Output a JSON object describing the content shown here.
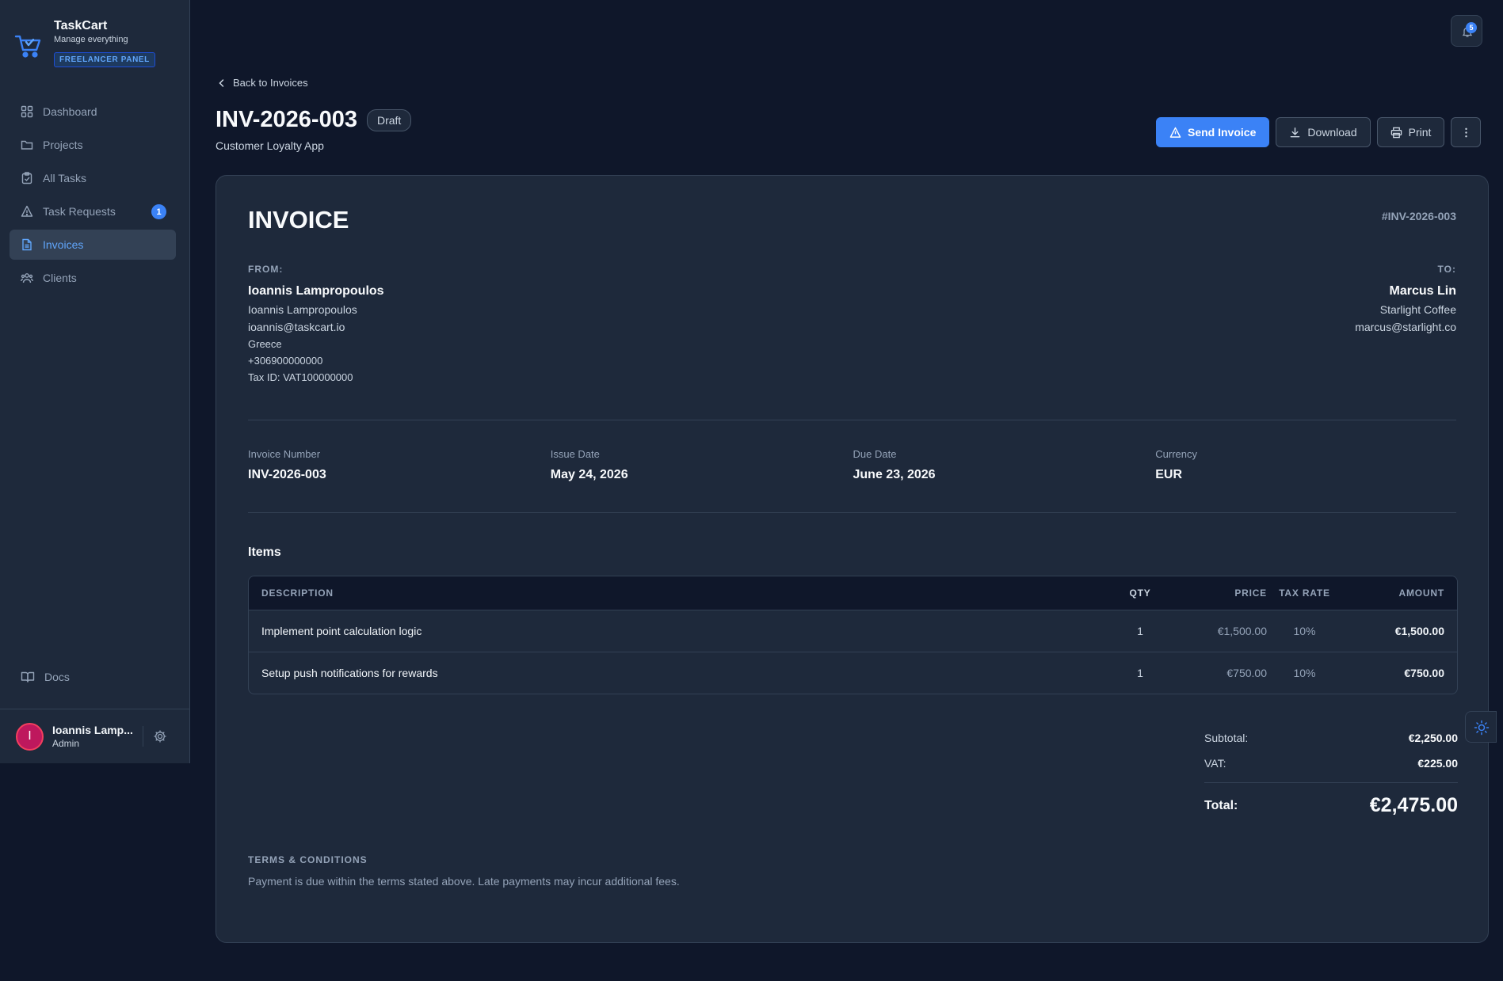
{
  "brand": {
    "name": "TaskCart",
    "tagline": "Manage everything",
    "panel": "FREELANCER PANEL"
  },
  "sidebar": {
    "items": [
      {
        "label": "Dashboard",
        "icon": "grid-icon"
      },
      {
        "label": "Projects",
        "icon": "folder-icon"
      },
      {
        "label": "All Tasks",
        "icon": "clipboard-check-icon"
      },
      {
        "label": "Task Requests",
        "icon": "warning-icon",
        "badge": "1"
      },
      {
        "label": "Invoices",
        "icon": "document-icon",
        "active": true
      },
      {
        "label": "Clients",
        "icon": "users-icon"
      }
    ],
    "docs": "Docs",
    "user": {
      "initial": "I",
      "name": "Ioannis Lamp...",
      "role": "Admin"
    }
  },
  "notifications": {
    "count": "5"
  },
  "header": {
    "back": "Back to Invoices",
    "title": "INV-2026-003",
    "status": "Draft",
    "subtitle": "Customer Loyalty App",
    "actions": {
      "send": "Send Invoice",
      "download": "Download",
      "print": "Print"
    }
  },
  "invoice": {
    "heading": "INVOICE",
    "number_ref": "#INV-2026-003",
    "from": {
      "label": "FROM:",
      "name": "Ioannis Lampropoulos",
      "company": "Ioannis Lampropoulos",
      "email": "ioannis@taskcart.io",
      "country": "Greece",
      "phone": "+306900000000",
      "tax_id": "Tax ID: VAT100000000"
    },
    "to": {
      "label": "TO:",
      "name": "Marcus Lin",
      "company": "Starlight Coffee",
      "email": "marcus@starlight.co"
    },
    "meta": [
      {
        "label": "Invoice Number",
        "value": "INV-2026-003"
      },
      {
        "label": "Issue Date",
        "value": "May 24, 2026"
      },
      {
        "label": "Due Date",
        "value": "June 23, 2026"
      },
      {
        "label": "Currency",
        "value": "EUR"
      }
    ],
    "items_title": "Items",
    "columns": {
      "description": "DESCRIPTION",
      "qty": "QTY",
      "price": "PRICE",
      "tax": "TAX RATE",
      "amount": "AMOUNT"
    },
    "items": [
      {
        "description": "Implement point calculation logic",
        "qty": "1",
        "price": "€1,500.00",
        "tax": "10%",
        "amount": "€1,500.00"
      },
      {
        "description": "Setup push notifications for rewards",
        "qty": "1",
        "price": "€750.00",
        "tax": "10%",
        "amount": "€750.00"
      }
    ],
    "totals": {
      "subtotal_label": "Subtotal:",
      "subtotal": "€2,250.00",
      "vat_label": "VAT:",
      "vat": "€225.00",
      "total_label": "Total:",
      "total": "€2,475.00"
    },
    "terms_label": "TERMS & CONDITIONS",
    "terms": "Payment is due within the terms stated above. Late payments may incur additional fees."
  }
}
